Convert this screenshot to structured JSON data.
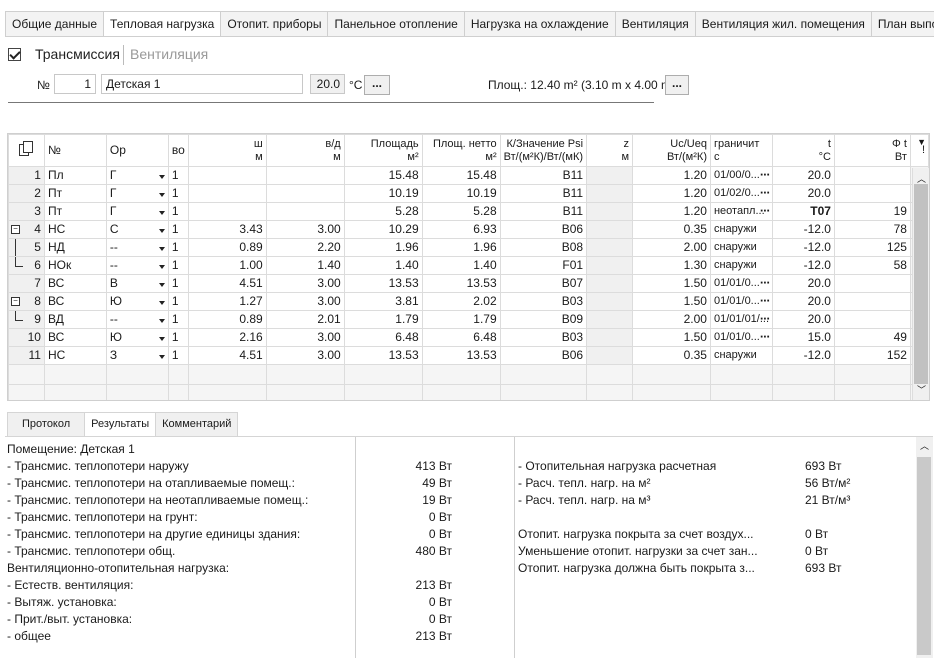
{
  "top_tabs": [
    "Общие данные",
    "Тепловая нагрузка",
    "Отопит. приборы",
    "Панельное отопление",
    "Нагрузка на охлаждение",
    "Вентиляция",
    "Вентиляция жил. помещения",
    "План выполне"
  ],
  "sub_tabs": {
    "transmission": "Трансмиссия",
    "ventilation": "Вентиляция"
  },
  "room": {
    "no_label": "№",
    "no_value": "1",
    "name_value": "Детская 1",
    "temp_value": "20.0",
    "temp_unit": "°C",
    "ellipsis": "...",
    "area_label": "Площ.: 12.40  m² (3.10 m x 4.00 m)"
  },
  "grid": {
    "headers": [
      {
        "l1": "",
        "l2": ""
      },
      {
        "l1": "№",
        "l2": ""
      },
      {
        "l1": "Ор",
        "l2": ""
      },
      {
        "l1": "во",
        "l2": ""
      },
      {
        "l1": "ш",
        "l2": "м"
      },
      {
        "l1": "в/д",
        "l2": "м"
      },
      {
        "l1": "Площадь",
        "l2": "м²"
      },
      {
        "l1": "Площ. нетто",
        "l2": "м²"
      },
      {
        "l1": "К/Значение Psi",
        "l2": "Вт/(м²К)/Вт/(мК)"
      },
      {
        "l1": "z",
        "l2": "м"
      },
      {
        "l1": "Uc/Ueq",
        "l2": "Вт/(м²К)"
      },
      {
        "l1": "граничит",
        "l2": "с"
      },
      {
        "l1": "t",
        "l2": "°C"
      },
      {
        "l1": "Φ t",
        "l2": "Вт"
      },
      {
        "l1": "!",
        "l2": ""
      }
    ],
    "rows": [
      {
        "n": "1",
        "type": "Пл",
        "or": "Г",
        "vo": "1",
        "w": "",
        "h": "",
        "area": "15.48",
        "net": "15.48",
        "k": "B11",
        "z": "",
        "uc": "1.20",
        "adj": "01/00/0...",
        "t": "20.0",
        "phi": "",
        "tbold": false
      },
      {
        "n": "2",
        "type": "Пт",
        "or": "Г",
        "vo": "1",
        "w": "",
        "h": "",
        "area": "10.19",
        "net": "10.19",
        "k": "B11",
        "z": "",
        "uc": "1.20",
        "adj": "01/02/0...",
        "t": "20.0",
        "phi": "",
        "tbold": false
      },
      {
        "n": "3",
        "type": "Пт",
        "or": "Г",
        "vo": "1",
        "w": "",
        "h": "",
        "area": "5.28",
        "net": "5.28",
        "k": "B11",
        "z": "",
        "uc": "1.20",
        "adj": "неотапл...",
        "t": "T07",
        "phi": "19",
        "tbold": true
      },
      {
        "n": "4",
        "type": "НС",
        "or": "С",
        "vo": "1",
        "w": "3.43",
        "h": "3.00",
        "area": "10.29",
        "net": "6.93",
        "k": "B06",
        "z": "",
        "uc": "0.35",
        "adj": "снаружи",
        "t": "-12.0",
        "phi": "78",
        "tbold": false
      },
      {
        "n": "5",
        "type": "НД",
        "or": "--",
        "vo": "1",
        "w": "0.89",
        "h": "2.20",
        "area": "1.96",
        "net": "1.96",
        "k": "B08",
        "z": "",
        "uc": "2.00",
        "adj": "снаружи",
        "t": "-12.0",
        "phi": "125",
        "tbold": false
      },
      {
        "n": "6",
        "type": "НОк",
        "or": "--",
        "vo": "1",
        "w": "1.00",
        "h": "1.40",
        "area": "1.40",
        "net": "1.40",
        "k": "F01",
        "z": "",
        "uc": "1.30",
        "adj": "снаружи",
        "t": "-12.0",
        "phi": "58",
        "tbold": false
      },
      {
        "n": "7",
        "type": "ВС",
        "or": "В",
        "vo": "1",
        "w": "4.51",
        "h": "3.00",
        "area": "13.53",
        "net": "13.53",
        "k": "B07",
        "z": "",
        "uc": "1.50",
        "adj": "01/01/0...",
        "t": "20.0",
        "phi": "",
        "tbold": false
      },
      {
        "n": "8",
        "type": "ВС",
        "or": "Ю",
        "vo": "1",
        "w": "1.27",
        "h": "3.00",
        "area": "3.81",
        "net": "2.02",
        "k": "B03",
        "z": "",
        "uc": "1.50",
        "adj": "01/01/0...",
        "t": "20.0",
        "phi": "",
        "tbold": false
      },
      {
        "n": "9",
        "type": "ВД",
        "or": "--",
        "vo": "1",
        "w": "0.89",
        "h": "2.01",
        "area": "1.79",
        "net": "1.79",
        "k": "B09",
        "z": "",
        "uc": "2.00",
        "adj": "01/01/01/...",
        "t": "20.0",
        "phi": "",
        "tbold": false
      },
      {
        "n": "10",
        "type": "ВС",
        "or": "Ю",
        "vo": "1",
        "w": "2.16",
        "h": "3.00",
        "area": "6.48",
        "net": "6.48",
        "k": "B03",
        "z": "",
        "uc": "1.50",
        "adj": "01/01/0...",
        "t": "15.0",
        "phi": "49",
        "tbold": false
      },
      {
        "n": "11",
        "type": "НС",
        "or": "З",
        "vo": "1",
        "w": "4.51",
        "h": "3.00",
        "area": "13.53",
        "net": "13.53",
        "k": "B06",
        "z": "",
        "uc": "0.35",
        "adj": "снаружи",
        "t": "-12.0",
        "phi": "152",
        "tbold": false
      }
    ]
  },
  "bottom_tabs": [
    "Протокол",
    "Результаты",
    "Комментарий"
  ],
  "results": {
    "room_title": "Помещение: Детская 1",
    "left": [
      {
        "label": " - Трансмис. теплопотери наружу",
        "value": "413 Вт"
      },
      {
        "label": "- Трансмис. теплопотери на отапливаемые помещ.:",
        "value": "49 Вт"
      },
      {
        "label": "- Трансмис. теплопотери на неотапливаемые помещ.:",
        "value": "19 Вт"
      },
      {
        "label": "- Трансмис. теплопотери на грунт:",
        "value": "0 Вт"
      },
      {
        "label": "- Трансмис. теплопотери на другие единицы здания:",
        "value": "0 Вт"
      },
      {
        "label": " - Трансмис. теплопотери общ.",
        "value": "480 Вт"
      },
      {
        "label": "Вентиляционно-отопительная нагрузка:",
        "value": ""
      },
      {
        "label": "- Естеств. вентиляция:",
        "value": "213 Вт"
      },
      {
        "label": "- Вытяж. установка:",
        "value": "0 Вт"
      },
      {
        "label": "- Прит./выт. установка:",
        "value": "0 Вт"
      },
      {
        "label": "  - общее",
        "value": "213 Вт"
      }
    ],
    "right_top": [
      {
        "label": " - Отопительная нагрузка расчетная",
        "value": "693 Вт"
      },
      {
        "label": " - Расч. тепл. нагр. на м²",
        "value": "56 Вт/м²"
      },
      {
        "label": " - Расч. тепл. нагр. на м³",
        "value": "21 Вт/м³"
      }
    ],
    "right_bottom": [
      {
        "label": "Отопит. нагрузка покрыта за счет воздух...",
        "value": "0 Вт"
      },
      {
        "label": "Уменьшение отопит. нагрузки за счет зан...",
        "value": "0 Вт"
      },
      {
        "label": "Отопит. нагрузка должна быть покрыта з...",
        "value": "693 Вт"
      }
    ]
  }
}
